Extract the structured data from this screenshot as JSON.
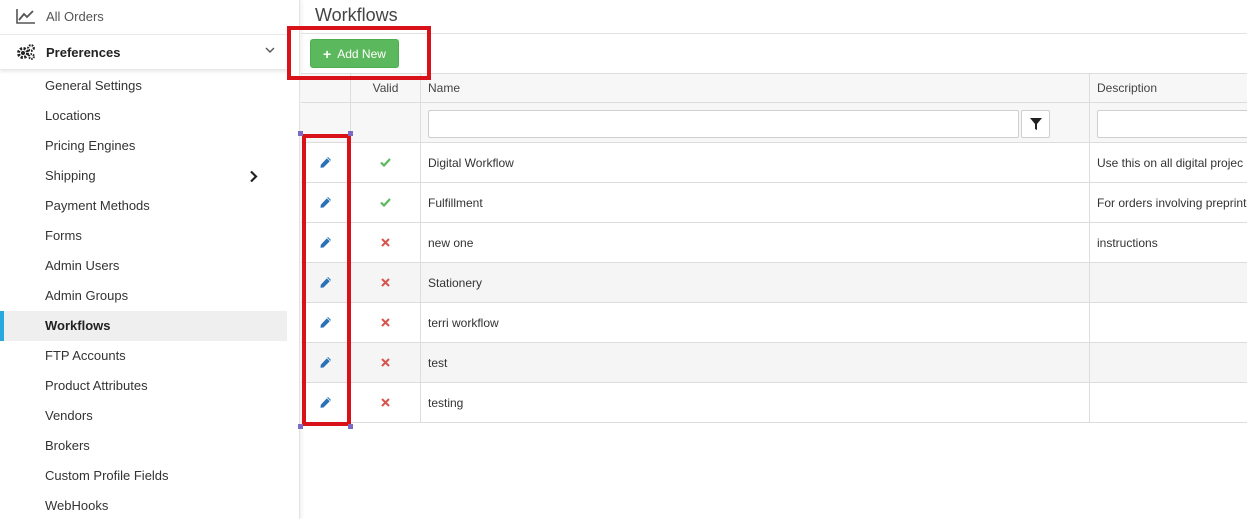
{
  "sidebar": {
    "all_orders": {
      "label": "All Orders",
      "icon": "line-chart-icon"
    },
    "preferences": {
      "label": "Preferences",
      "icon": "gears-icon"
    },
    "items": [
      {
        "label": "General Settings"
      },
      {
        "label": "Locations"
      },
      {
        "label": "Pricing Engines"
      },
      {
        "label": "Shipping"
      },
      {
        "label": "Payment Methods"
      },
      {
        "label": "Forms"
      },
      {
        "label": "Admin Users"
      },
      {
        "label": "Admin Groups"
      },
      {
        "label": "Workflows"
      },
      {
        "label": "FTP Accounts"
      },
      {
        "label": "Product Attributes"
      },
      {
        "label": "Vendors"
      },
      {
        "label": "Brokers"
      },
      {
        "label": "Custom Profile Fields"
      },
      {
        "label": "WebHooks"
      }
    ],
    "active_item": "Workflows",
    "accent_color": "#29a8e0"
  },
  "main": {
    "title": "Workflows",
    "add_button": {
      "label": "Add New",
      "color": "#5cb85c"
    },
    "grid": {
      "headers": {
        "valid": "Valid",
        "name": "Name",
        "description": "Description"
      },
      "filter": {
        "name_value": "",
        "description_value": ""
      },
      "rows": [
        {
          "valid": true,
          "name": "Digital Workflow",
          "description": "Use this on all digital projec"
        },
        {
          "valid": true,
          "name": "Fulfillment",
          "description": "For orders involving preprinte"
        },
        {
          "valid": false,
          "name": "new one",
          "description": "instructions"
        },
        {
          "valid": false,
          "name": "Stationery",
          "description": ""
        },
        {
          "valid": false,
          "name": "terri workflow",
          "description": ""
        },
        {
          "valid": false,
          "name": "test",
          "description": ""
        },
        {
          "valid": false,
          "name": "testing",
          "description": ""
        }
      ]
    },
    "colors": {
      "valid_check": "#5cb85c",
      "invalid_x": "#d9534f",
      "edit_icon": "#2a72b5",
      "highlight": "#d9121a"
    }
  }
}
